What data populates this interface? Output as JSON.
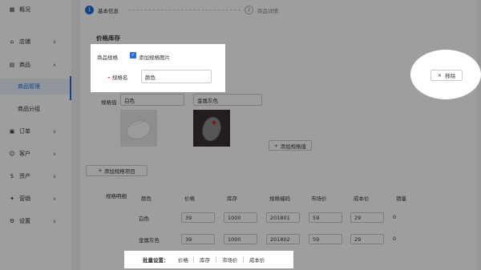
{
  "sidebar": {
    "items": [
      {
        "label": "概况",
        "icon": "grid-icon"
      },
      {
        "label": "店铺",
        "icon": "shop-icon"
      },
      {
        "label": "商品",
        "icon": "goods-icon"
      },
      {
        "label": "订单",
        "icon": "order-icon"
      },
      {
        "label": "客户",
        "icon": "user-icon"
      },
      {
        "label": "资产",
        "icon": "asset-icon"
      },
      {
        "label": "营销",
        "icon": "marketing-icon"
      },
      {
        "label": "设置",
        "icon": "gear-icon"
      }
    ],
    "sub_items": [
      "商品管理",
      "商品分组"
    ]
  },
  "steps": [
    {
      "num": "1",
      "label": "基本信息"
    },
    {
      "num": "2",
      "label": "商品详情"
    }
  ],
  "section_title": "价格库存",
  "spec": {
    "label": "商品规格",
    "add_image_label": "添加规格图片",
    "name_label": "规格名",
    "name_value": "颜色",
    "value_label": "规格值",
    "values": [
      "白色",
      "金属灰色"
    ],
    "add_value_label": "添加规格值",
    "add_item_label": "添加规格项目",
    "remove_label": "移除"
  },
  "detail": {
    "label": "规格明细",
    "headers": [
      "颜色",
      "价格",
      "库存",
      "规格编码",
      "市场价",
      "成本价",
      "销量"
    ],
    "rows": [
      {
        "color": "白色",
        "price": "39",
        "stock": "1000",
        "code": "201801",
        "market": "59",
        "cost": "29",
        "sales": "0"
      },
      {
        "color": "金属灰色",
        "price": "39",
        "stock": "1000",
        "code": "201802",
        "market": "59",
        "cost": "29",
        "sales": "0"
      }
    ]
  },
  "batch": {
    "label": "批量设置：",
    "items": [
      "价格",
      "库存",
      "市场价",
      "成本价"
    ]
  },
  "colors": {
    "accent": "#1f6fe0"
  }
}
